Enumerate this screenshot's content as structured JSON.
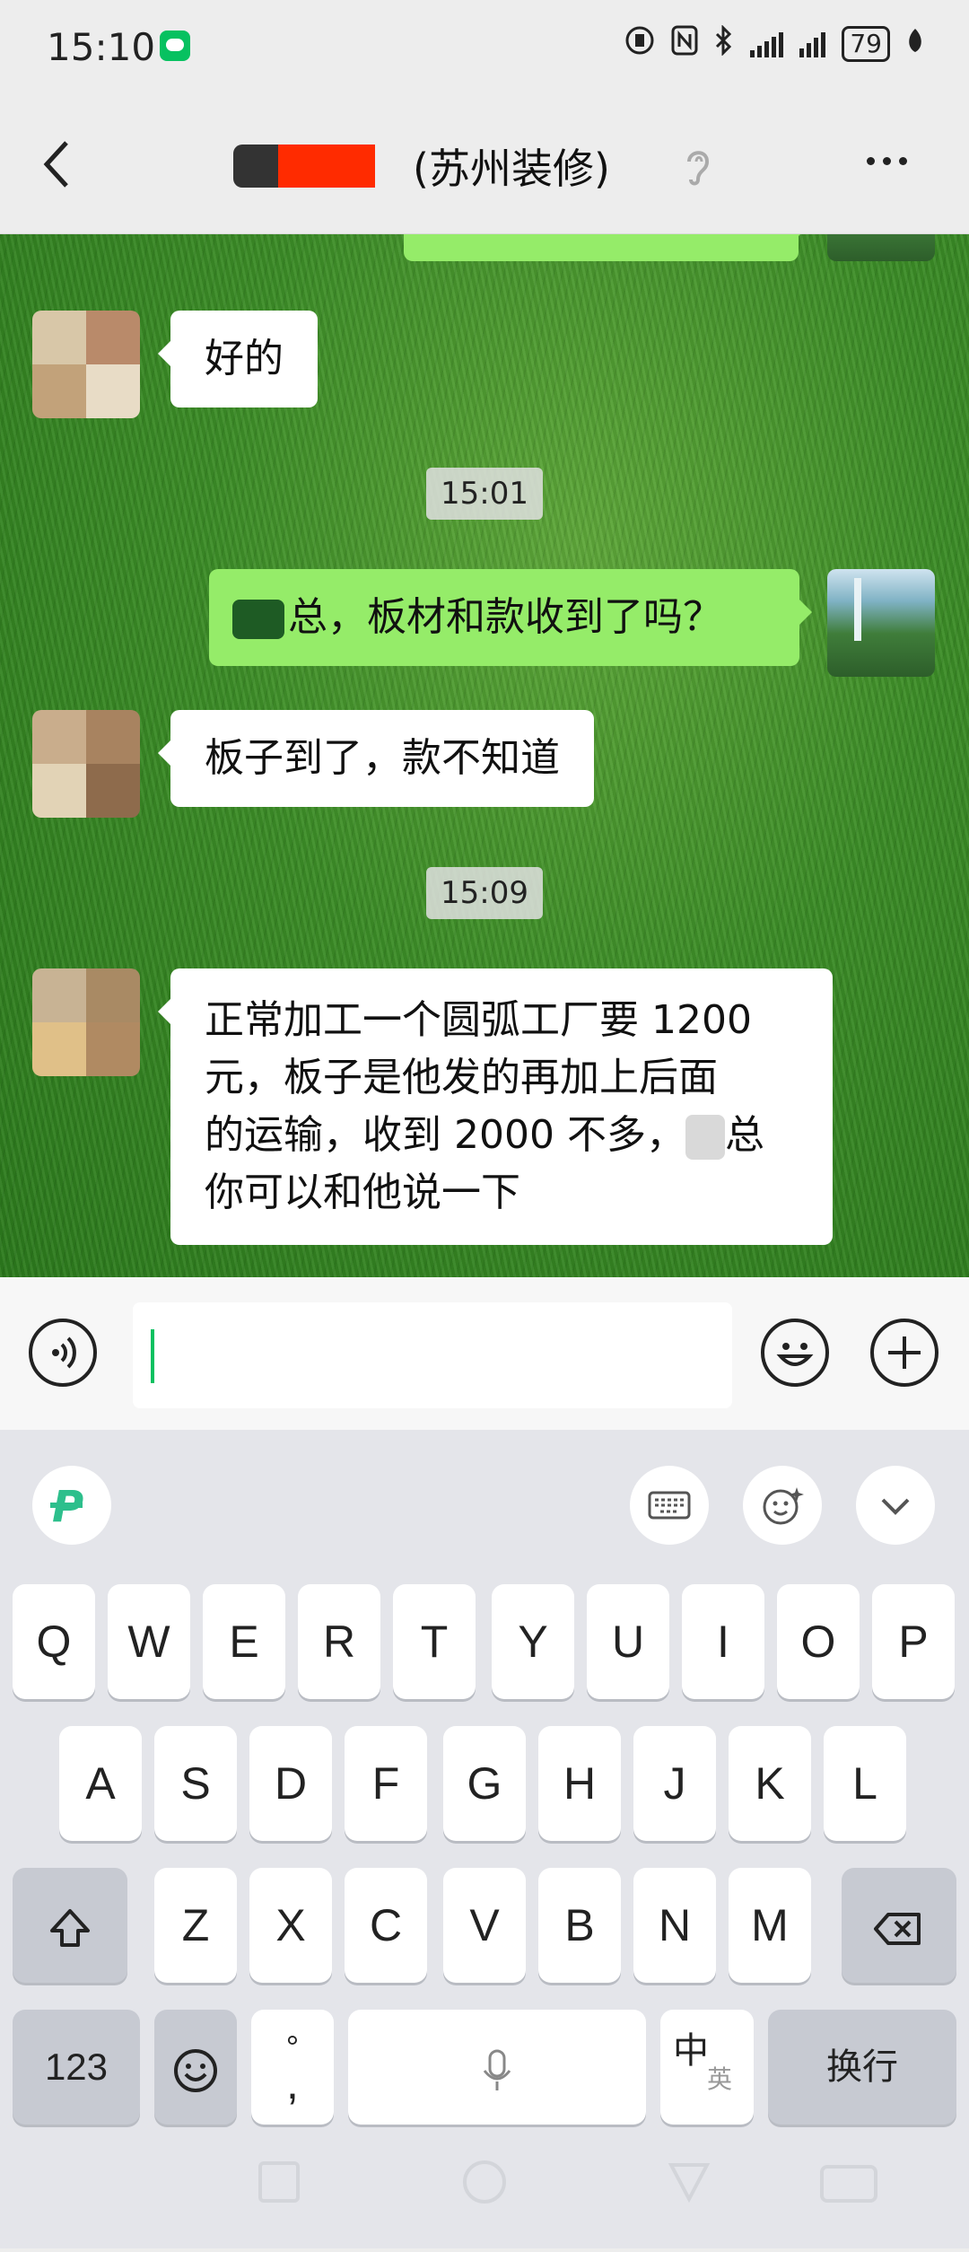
{
  "status_bar": {
    "time": "15:10",
    "battery": "79"
  },
  "header": {
    "title_suffix": "(苏州装修)"
  },
  "messages": {
    "m1": {
      "text": "好的"
    },
    "t1": {
      "text": "15:01"
    },
    "m2": {
      "text": "总，板材和款收到了吗？"
    },
    "m3": {
      "text": "板子到了，款不知道"
    },
    "t2": {
      "text": "15:09"
    },
    "m4": {
      "line1": "正常加工一个圆弧工厂要 1200",
      "line2": "元，板子是他发的再加上后面",
      "line3a": "的运输，收到 2000 不多，",
      "line3b": "总",
      "line4": "你可以和他说一下"
    }
  },
  "keyboard": {
    "row1": [
      "Q",
      "W",
      "E",
      "R",
      "T",
      "Y",
      "U",
      "I",
      "O",
      "P"
    ],
    "row2": [
      "A",
      "S",
      "D",
      "F",
      "G",
      "H",
      "J",
      "K",
      "L"
    ],
    "row3": [
      "Z",
      "X",
      "C",
      "V",
      "B",
      "N",
      "M"
    ],
    "num_label": "123",
    "punct_top": "°",
    "punct_bottom": ",",
    "lang_main": "中",
    "lang_sub": "英",
    "enter_label": "换行"
  },
  "colors": {
    "sent_bubble": "#95ec69",
    "received_bubble": "#ffffff",
    "accent": "#07c160"
  }
}
